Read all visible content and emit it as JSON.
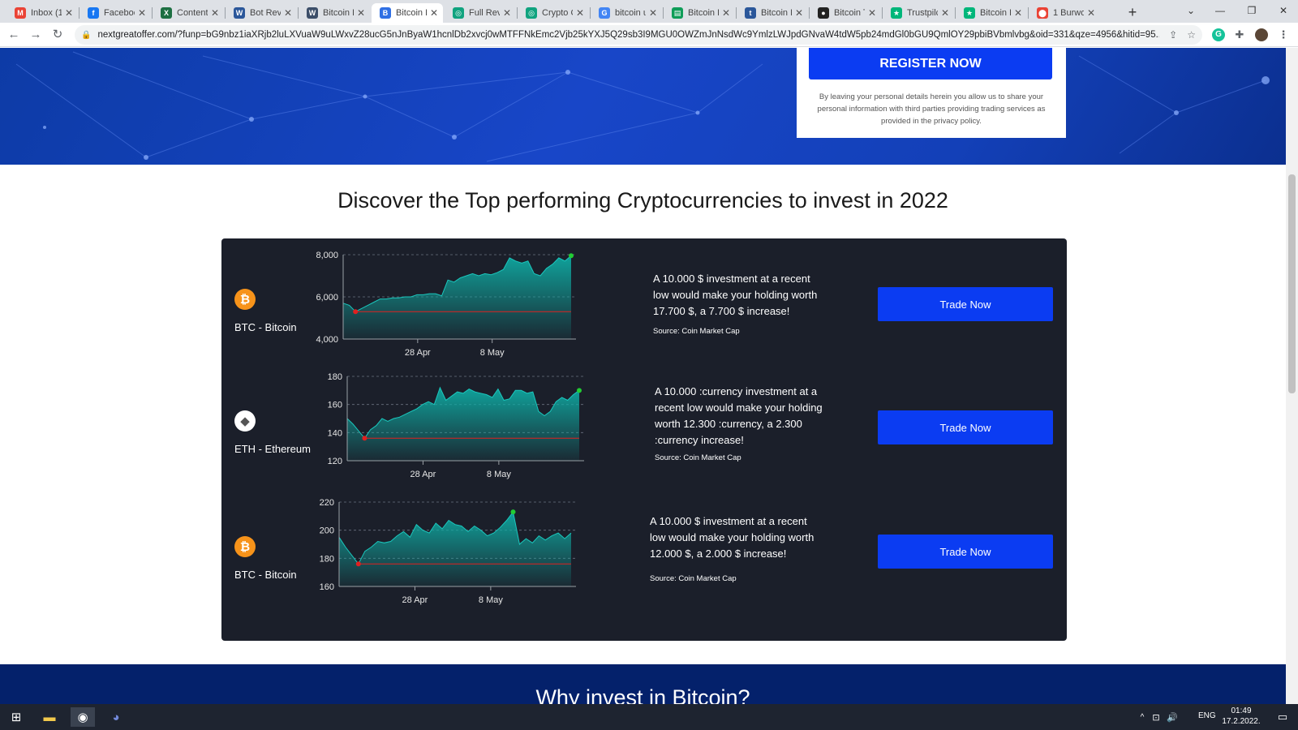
{
  "browser": {
    "tabs": [
      {
        "title": "Inbox (1",
        "icon": "gmail-icon",
        "color": "#ea4335",
        "glyph": "M"
      },
      {
        "title": "Faceboo",
        "icon": "facebook-icon",
        "color": "#1877f2",
        "glyph": "f"
      },
      {
        "title": "Content",
        "icon": "excel-icon",
        "color": "#1d6f42",
        "glyph": "X"
      },
      {
        "title": "Bot Revi",
        "icon": "word-icon",
        "color": "#2b579a",
        "glyph": "W"
      },
      {
        "title": "Bitcoin L",
        "icon": "wordpress-icon",
        "color": "#3c4e69",
        "glyph": "W"
      },
      {
        "title": "Bitcoin L",
        "icon": "site-icon",
        "color": "#2f6fe4",
        "glyph": "B",
        "active": true
      },
      {
        "title": "Full Revi",
        "icon": "chatgpt-icon",
        "color": "#10a37f",
        "glyph": "◎"
      },
      {
        "title": "Crypto C",
        "icon": "chatgpt-icon",
        "color": "#10a37f",
        "glyph": "◎"
      },
      {
        "title": "bitcoin u",
        "icon": "google-icon",
        "color": "#4285f4",
        "glyph": "G"
      },
      {
        "title": "Bitcoin L",
        "icon": "sheets-icon",
        "color": "#0f9d58",
        "glyph": "▤"
      },
      {
        "title": "Bitcoin L",
        "icon": "txt-icon",
        "color": "#2b579a",
        "glyph": "t"
      },
      {
        "title": "Bitcoin T",
        "icon": "circle-icon",
        "color": "#222222",
        "glyph": "●"
      },
      {
        "title": "Trustpilc",
        "icon": "trustpilot-icon",
        "color": "#00b67a",
        "glyph": "★"
      },
      {
        "title": "Bitcoin L",
        "icon": "trustpilot-icon",
        "color": "#00b67a",
        "glyph": "★"
      },
      {
        "title": "1 Burwo",
        "icon": "maps-icon",
        "color": "#ea4335",
        "glyph": "⬤"
      }
    ],
    "new_tab": "+",
    "url": "nextgreatoffer.com/?funp=bG9nbz1iaXRjb2luLXVuaW9uLWxvZ28ucG5nJnByaW1hcnlDb2xvcj0wMTFFNkEmc2Vjb25kYXJ5Q29sb3I9MGU0OWZmJnNsdWc9YmlzLWJpdGNvaW4tdW5pb24mdGl0bGU9QmlOY29pbiBVbmlvbg&oid=331&qze=4956&hitid=95..."
  },
  "hero": {
    "register_label": "REGISTER NOW",
    "register_note": "By leaving your personal details herein you allow us to share your personal information with third parties providing trading services as provided in the privacy policy."
  },
  "section": {
    "heading": "Discover the Top performing Cryptocurrencies to invest in 2022"
  },
  "rows": [
    {
      "coin_name": "BTC - Bitcoin",
      "coin": "btc",
      "description": "A 10.000 $ investment at a recent low would make your holding worth 17.700 $, a 7.700 $ increase!",
      "source": "Source: Coin Market Cap",
      "trade_label": "Trade Now"
    },
    {
      "coin_name": "ETH - Ethereum",
      "coin": "eth",
      "description": "A 10.000 :currency investment at a recent low would make your holding worth 12.300 :currency, a 2.300 :currency increase!",
      "source": "Source: Coin Market Cap",
      "trade_label": "Trade Now"
    },
    {
      "coin_name": "BTC - Bitcoin",
      "coin": "btc",
      "description": "A 10.000 $ investment at a recent low would make your holding worth 12.000 $, a 2.000 $ increase!",
      "source": "Source: Coin Market Cap",
      "trade_label": "Trade Now"
    }
  ],
  "chart_data": [
    {
      "type": "area",
      "title": "",
      "xlabel": "",
      "ylabel": "",
      "ylim": [
        4000,
        8000
      ],
      "yticks": [
        "4,000",
        "6,000",
        "8,000"
      ],
      "xticks": [
        "28 Apr",
        "8 May"
      ],
      "grid": "dashed horizontal",
      "low_marker_index": 2,
      "high_marker_index": 37,
      "values": [
        5700,
        5600,
        5300,
        5450,
        5600,
        5750,
        5900,
        5900,
        5950,
        5950,
        6000,
        6000,
        6100,
        6100,
        6150,
        6150,
        6050,
        6800,
        6700,
        6900,
        7000,
        7100,
        7000,
        7100,
        7050,
        7150,
        7300,
        7850,
        7700,
        7600,
        7700,
        7100,
        7000,
        7350,
        7550,
        7850,
        7700,
        7950
      ],
      "colors": {
        "fill": "#0fa9a1",
        "line": "#1bc7bd",
        "low": "#e02020",
        "high": "#22cc33"
      }
    },
    {
      "type": "area",
      "title": "",
      "xlabel": "",
      "ylabel": "",
      "ylim": [
        120,
        180
      ],
      "yticks": [
        "120",
        "140",
        "160",
        "180"
      ],
      "xticks": [
        "28 Apr",
        "8 May"
      ],
      "grid": "dashed horizontal",
      "low_marker_index": 3,
      "high_marker_index": 40,
      "values": [
        150,
        146,
        141,
        136,
        142,
        145,
        150,
        148,
        150,
        151,
        153,
        155,
        157,
        160,
        162,
        160,
        172,
        163,
        166,
        169,
        168,
        171,
        169,
        168,
        167,
        165,
        171,
        163,
        164,
        170,
        170,
        168,
        169,
        155,
        152,
        155,
        162,
        165,
        163,
        167,
        170
      ],
      "colors": {
        "fill": "#0fa9a1",
        "line": "#1bc7bd",
        "low": "#e02020",
        "high": "#22cc33"
      }
    },
    {
      "type": "area",
      "title": "",
      "xlabel": "",
      "ylabel": "",
      "ylim": [
        160,
        220
      ],
      "yticks": [
        "160",
        "180",
        "200",
        "220"
      ],
      "xticks": [
        "28 Apr",
        "8 May"
      ],
      "grid": "dashed horizontal",
      "low_marker_index": 3,
      "high_marker_index": 27,
      "values": [
        195,
        188,
        182,
        176,
        185,
        188,
        192,
        191,
        192,
        196,
        199,
        195,
        204,
        200,
        198,
        205,
        201,
        207,
        204,
        203,
        199,
        203,
        200,
        196,
        198,
        202,
        207,
        213,
        190,
        194,
        191,
        196,
        193,
        196,
        198,
        194,
        198
      ],
      "colors": {
        "fill": "#0fa9a1",
        "line": "#1bc7bd",
        "low": "#e02020",
        "high": "#22cc33"
      }
    }
  ],
  "section2": {
    "heading": "Why invest in Bitcoin?"
  },
  "taskbar": {
    "lang": "ENG",
    "time": "01:49",
    "date": "17.2.2022."
  }
}
